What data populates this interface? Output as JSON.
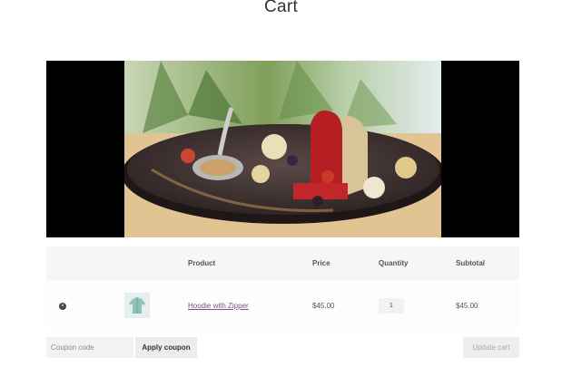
{
  "page": {
    "title": "Cart"
  },
  "cart": {
    "headers": {
      "remove": "",
      "thumbnail": "",
      "product": "Product",
      "price": "Price",
      "quantity": "Quantity",
      "subtotal": "Subtotal"
    },
    "items": [
      {
        "remove": "×",
        "product": "Hoodie with Zipper",
        "price": "$45.00",
        "quantity": "1",
        "subtotal": "$45.00"
      }
    ]
  },
  "actions": {
    "coupon_placeholder": "Coupon code",
    "apply_coupon": "Apply coupon",
    "update_cart": "Update cart"
  },
  "colors": {
    "accent_link": "#7a4f8c",
    "header_bg": "#f6f6f6",
    "text": "#43454b"
  }
}
